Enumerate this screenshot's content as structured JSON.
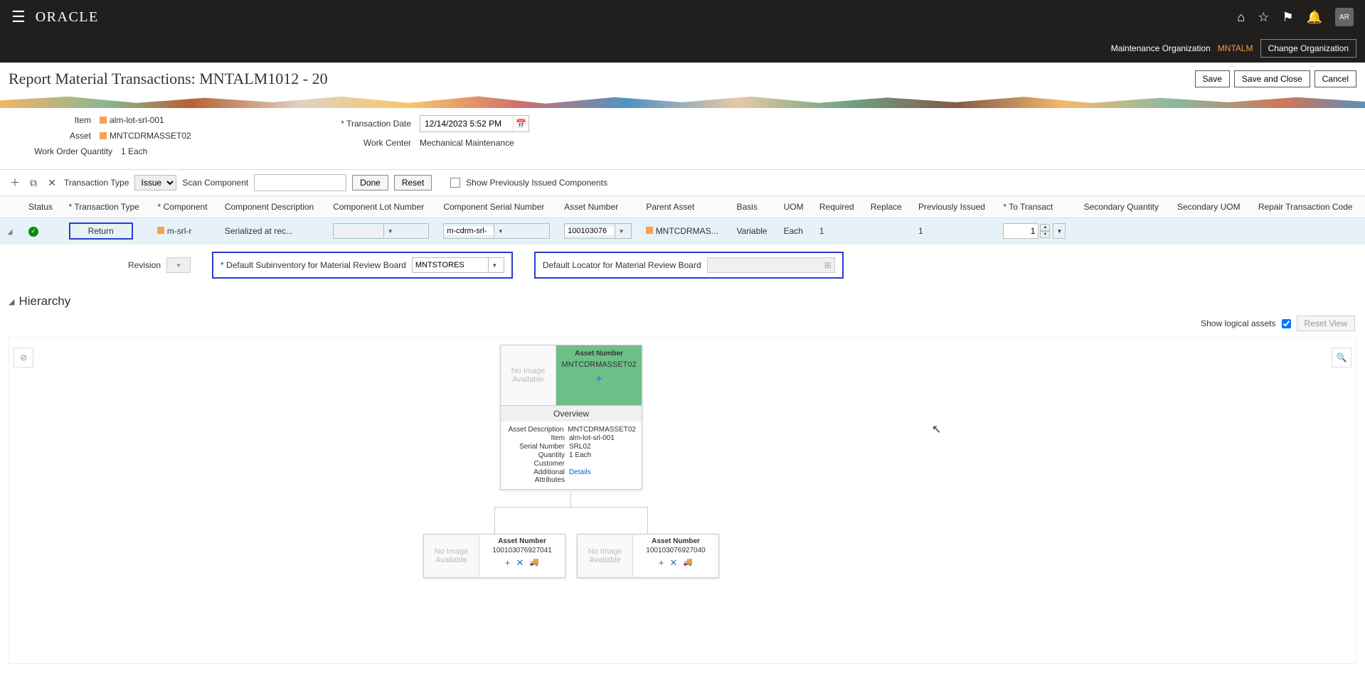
{
  "header": {
    "logo": "ORACLE",
    "avatar": "AR",
    "org_label": "Maintenance Organization",
    "org_value": "MNTALM",
    "change_org": "Change Organization"
  },
  "page": {
    "title": "Report Material Transactions: MNTALM1012 - 20",
    "save": "Save",
    "save_close": "Save and Close",
    "cancel": "Cancel"
  },
  "form": {
    "item_label": "Item",
    "item_value": "alm-lot-srl-001",
    "asset_label": "Asset",
    "asset_value": "MNTCDRMASSET02",
    "woq_label": "Work Order Quantity",
    "woq_value": "1 Each",
    "txn_date_label": "Transaction Date",
    "txn_date_value": "12/14/2023 5:52 PM",
    "work_center_label": "Work Center",
    "work_center_value": "Mechanical Maintenance"
  },
  "toolbar": {
    "txn_type_label": "Transaction Type",
    "txn_type_value": "Issue",
    "scan_label": "Scan Component",
    "done": "Done",
    "reset": "Reset",
    "show_prev": "Show Previously Issued Components"
  },
  "columns": {
    "status": "Status",
    "txn_type": "Transaction Type",
    "component": "Component",
    "comp_desc": "Component Description",
    "lot": "Component Lot Number",
    "serial": "Component Serial Number",
    "asset_num": "Asset Number",
    "parent": "Parent Asset",
    "basis": "Basis",
    "uom": "UOM",
    "required": "Required",
    "replace": "Replace",
    "prev_issued": "Previously Issued",
    "to_transact": "To Transact",
    "sec_qty": "Secondary Quantity",
    "sec_uom": "Secondary UOM",
    "repair": "Repair Transaction Code"
  },
  "row": {
    "txn_type": "Return",
    "component": "m-srl-r",
    "desc": "Serialized at rec...",
    "serial": "m-cdrm-srl-",
    "asset_num": "100103076",
    "parent": "MNTCDRMAS...",
    "basis": "Variable",
    "uom": "Each",
    "required": "1",
    "prev_issued": "1",
    "to_transact": "1"
  },
  "subrow": {
    "revision": "Revision",
    "def_subinv": "Default Subinventory for Material Review Board",
    "subinv_value": "MNTSTORES",
    "def_locator": "Default Locator for Material Review Board"
  },
  "hierarchy": {
    "title": "Hierarchy",
    "show_logical": "Show logical assets",
    "reset_view": "Reset View",
    "overview": "Overview",
    "asset_num_label": "Asset Number",
    "no_image": "No Image Available",
    "main": {
      "asset": "MNTCDRMASSET02",
      "desc_label": "Asset Description",
      "desc_value": "MNTCDRMASSET02",
      "item_label": "Item",
      "item_value": "alm-lot-srl-001",
      "serial_label": "Serial Number",
      "serial_value": "SRL02",
      "qty_label": "Quantity",
      "qty_value": "1 Each",
      "cust_label": "Customer",
      "attr_label": "Additional Attributes",
      "details": "Details"
    },
    "child1": {
      "asset": "100103076927041"
    },
    "child2": {
      "asset": "100103076927040"
    }
  }
}
